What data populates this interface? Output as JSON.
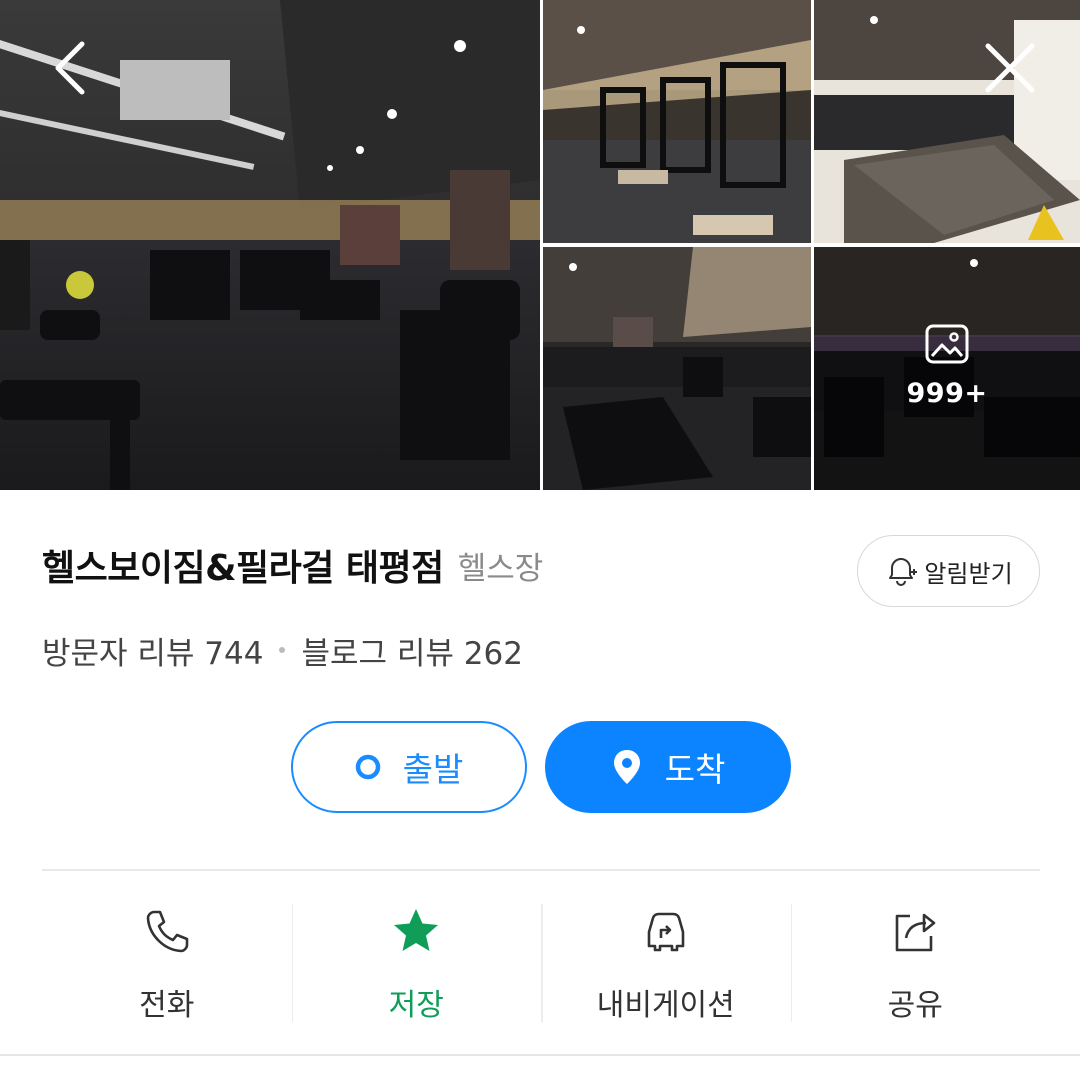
{
  "gallery": {
    "more_count": "999+"
  },
  "place": {
    "name": "헬스보이짐&필라걸 태평점",
    "category": "헬스장",
    "alert_label": "알림받기"
  },
  "reviews": {
    "visitor": "방문자 리뷰 744",
    "blog": "블로그 리뷰 262"
  },
  "route": {
    "depart_label": "출발",
    "arrive_label": "도착"
  },
  "actions": [
    {
      "label": "전화",
      "icon": "phone-icon"
    },
    {
      "label": "저장",
      "icon": "star-icon",
      "color": "#0f9d58"
    },
    {
      "label": "내비게이션",
      "icon": "car-navigation-icon"
    },
    {
      "label": "공유",
      "icon": "share-icon"
    }
  ],
  "colors": {
    "accent": "#0d84ff",
    "saved": "#0f9d58"
  }
}
